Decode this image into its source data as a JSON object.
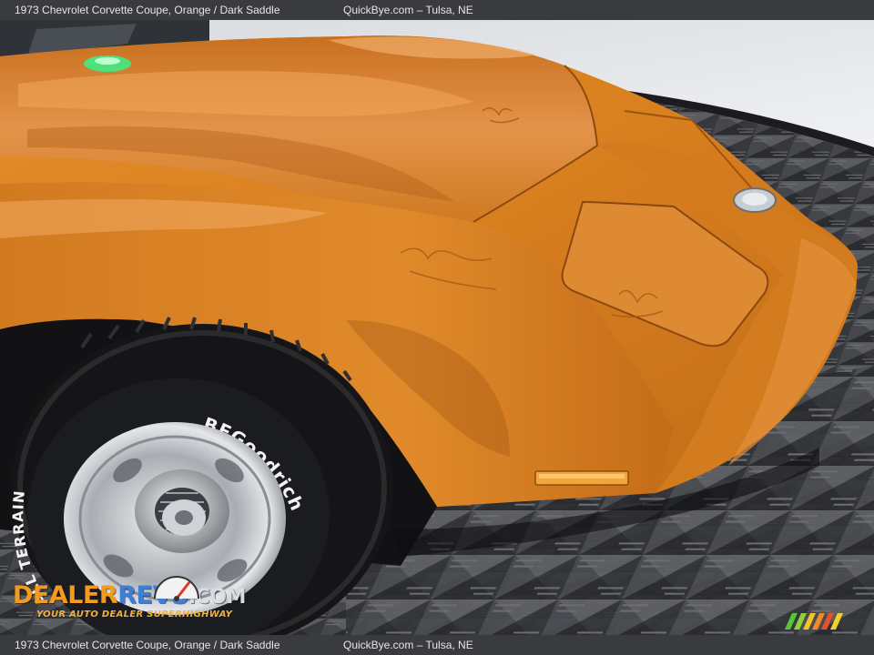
{
  "caption": {
    "title": "1973 Chevrolet Corvette Coupe,  Orange / Dark Saddle",
    "site": "QuickBye.com – Tulsa, NE"
  },
  "watermark": {
    "brand_part1": "DEALER",
    "brand_part2": "REVS",
    "brand_part3": ".COM",
    "tagline": "YOUR AUTO DEALER SUPERHIGHWAY"
  },
  "tire": {
    "brand_text": "BFGoodrich",
    "side_text": "ALL TERRAIN"
  },
  "colors": {
    "paint_orange": "#d9801f",
    "paint_highlight": "#f2a757",
    "paint_shadow": "#a85a14",
    "floor_dark": "#2a2b2e",
    "floor_light": "#5b5d62",
    "wall": "#e9ebee",
    "caption_bg": "#3a3b3e"
  },
  "icons": [
    "speedometer-icon",
    "stripes-logo-icon"
  ]
}
